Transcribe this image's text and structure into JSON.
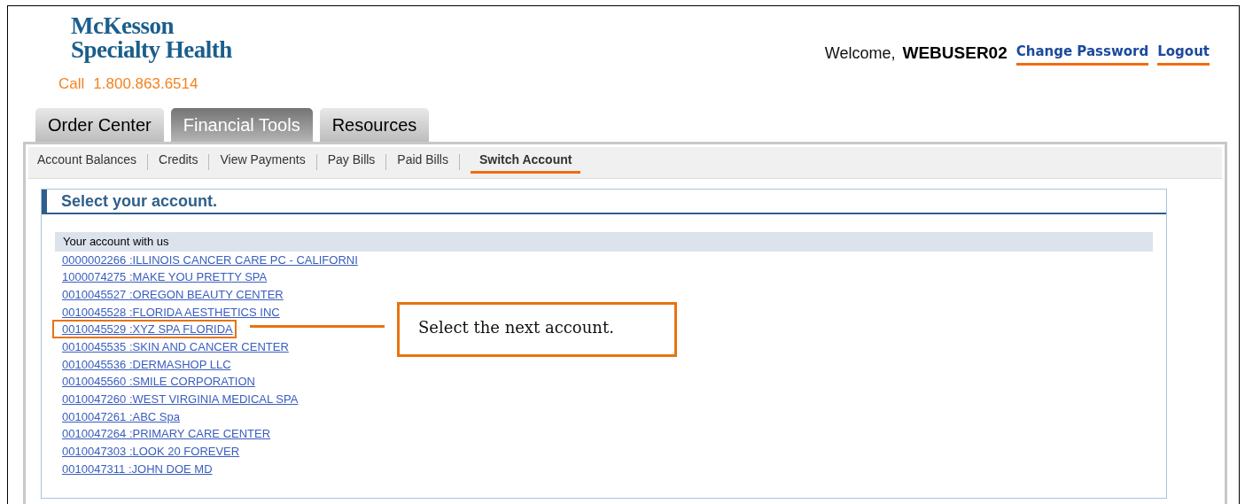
{
  "header": {
    "logo_lines": [
      "McKesson",
      "Specialty Health"
    ],
    "call_label": "Call",
    "phone": "1.800.863.6514",
    "welcome": "Welcome,",
    "username": "WEBUSER02",
    "links": [
      "Change Password",
      "Logout"
    ]
  },
  "tabs": [
    {
      "label": "Order Center",
      "selected": false
    },
    {
      "label": "Financial Tools",
      "selected": true
    },
    {
      "label": "Resources",
      "selected": false
    }
  ],
  "subnav": [
    {
      "label": "Account Balances",
      "selected": false
    },
    {
      "label": "Credits",
      "selected": false
    },
    {
      "label": "View Payments",
      "selected": false
    },
    {
      "label": "Pay Bills",
      "selected": false
    },
    {
      "label": "Paid Bills",
      "selected": false
    },
    {
      "label": "Switch Account",
      "selected": true
    }
  ],
  "panel": {
    "title": "Select your account.",
    "list_header": "Your account with us"
  },
  "accounts": [
    {
      "label": "0000002266 :ILLINOIS CANCER CARE PC - CALIFORNI",
      "highlighted": false
    },
    {
      "label": "1000074275 :MAKE YOU PRETTY SPA",
      "highlighted": false
    },
    {
      "label": "0010045527 :OREGON BEAUTY CENTER",
      "highlighted": false
    },
    {
      "label": "0010045528 :FLORIDA AESTHETICS INC",
      "highlighted": false
    },
    {
      "label": "0010045529 :XYZ SPA FLORIDA",
      "highlighted": true
    },
    {
      "label": "0010045535 :SKIN AND CANCER CENTER",
      "highlighted": false
    },
    {
      "label": "0010045536 :DERMASHOP LLC",
      "highlighted": false
    },
    {
      "label": "0010045560 :SMILE CORPORATION",
      "highlighted": false
    },
    {
      "label": "0010047260 :WEST VIRGINIA MEDICAL SPA",
      "highlighted": false
    },
    {
      "label": "0010047261 :ABC Spa",
      "highlighted": false
    },
    {
      "label": "0010047264 :PRIMARY CARE CENTER",
      "highlighted": false
    },
    {
      "label": "0010047303 :LOOK 20 FOREVER",
      "highlighted": false
    },
    {
      "label": "0010047311 :JOHN DOE MD",
      "highlighted": false
    }
  ],
  "callout": {
    "text": "Select the next account."
  }
}
